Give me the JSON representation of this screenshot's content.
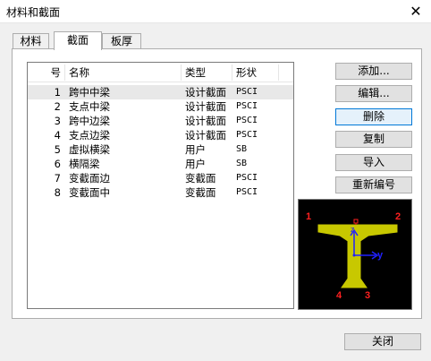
{
  "window": {
    "title": "材料和截面",
    "close_glyph": "✕"
  },
  "tabs": [
    {
      "label": "材料",
      "active": false
    },
    {
      "label": "截面",
      "active": true
    },
    {
      "label": "板厚",
      "active": false
    }
  ],
  "table": {
    "columns": [
      "号",
      "名称",
      "类型",
      "形状"
    ],
    "rows": [
      {
        "no": "1",
        "name": "跨中中梁",
        "type": "设计截面",
        "shape": "PSCI",
        "selected": true
      },
      {
        "no": "2",
        "name": "支点中梁",
        "type": "设计截面",
        "shape": "PSCI"
      },
      {
        "no": "3",
        "name": "跨中边梁",
        "type": "设计截面",
        "shape": "PSCI"
      },
      {
        "no": "4",
        "name": "支点边梁",
        "type": "设计截面",
        "shape": "PSCI"
      },
      {
        "no": "5",
        "name": "虚拟横梁",
        "type": "用户",
        "shape": "SB"
      },
      {
        "no": "6",
        "name": "横隔梁",
        "type": "用户",
        "shape": "SB"
      },
      {
        "no": "7",
        "name": "变截面边",
        "type": "变截面",
        "shape": "PSCI"
      },
      {
        "no": "8",
        "name": "变截面中",
        "type": "变截面",
        "shape": "PSCI"
      }
    ]
  },
  "buttons": {
    "add": "添加...",
    "edit": "编辑...",
    "delete": "删除",
    "copy": "复制",
    "import": "导入",
    "renumber": "重新编号",
    "close": "关闭"
  },
  "preview": {
    "labels": {
      "p1": "1",
      "p2": "2",
      "p3": "3",
      "p4": "4",
      "z": "z",
      "y": "y"
    },
    "colors": {
      "section_fill": "#c8c800",
      "point_label": "#ff2020",
      "axis": "#2020ff",
      "background": "#000000"
    }
  }
}
